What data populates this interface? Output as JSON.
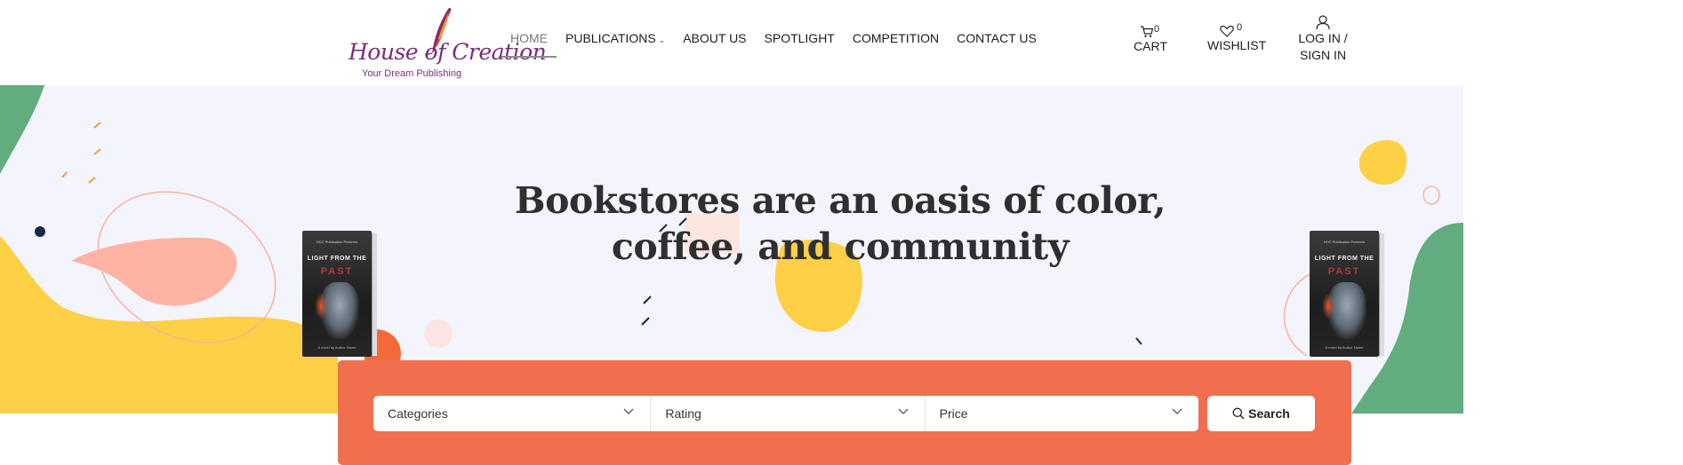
{
  "logo": {
    "name": "House of Creation",
    "tagline": "Your Dream Publishing"
  },
  "nav": {
    "items": [
      {
        "label": "HOME",
        "active": true
      },
      {
        "label": "PUBLICATIONS",
        "has_dropdown": true
      },
      {
        "label": "ABOUT US"
      },
      {
        "label": "SPOTLIGHT"
      },
      {
        "label": "COMPETITION"
      },
      {
        "label": "CONTACT US"
      }
    ]
  },
  "header_actions": {
    "cart": {
      "label": "CART",
      "count": "0",
      "icon": "cart-icon"
    },
    "wishlist": {
      "label": "WISHLIST",
      "count": "0",
      "icon": "heart-icon"
    },
    "account": {
      "label_line1": "LOG IN /",
      "label_line2": "SIGN IN",
      "icon": "user-icon"
    }
  },
  "hero": {
    "title_line1": "Bookstores are an oasis of color,",
    "title_line2": "coffee, and community"
  },
  "book": {
    "publisher_line": "HOC Publication Presents",
    "title": "LIGHT FROM THE",
    "subtitle": "PAST",
    "author": "A novel by Author Name"
  },
  "search": {
    "filters": [
      {
        "label": "Categories"
      },
      {
        "label": "Rating"
      },
      {
        "label": "Price"
      }
    ],
    "button_label": "Search"
  },
  "colors": {
    "accent": "#ef6f4f",
    "hero_bg": "#f4f4fc",
    "green": "#62ad7f",
    "yellow": "#fdd045",
    "pink": "#ffb4a3",
    "brand_purple": "#7b2c7a"
  }
}
